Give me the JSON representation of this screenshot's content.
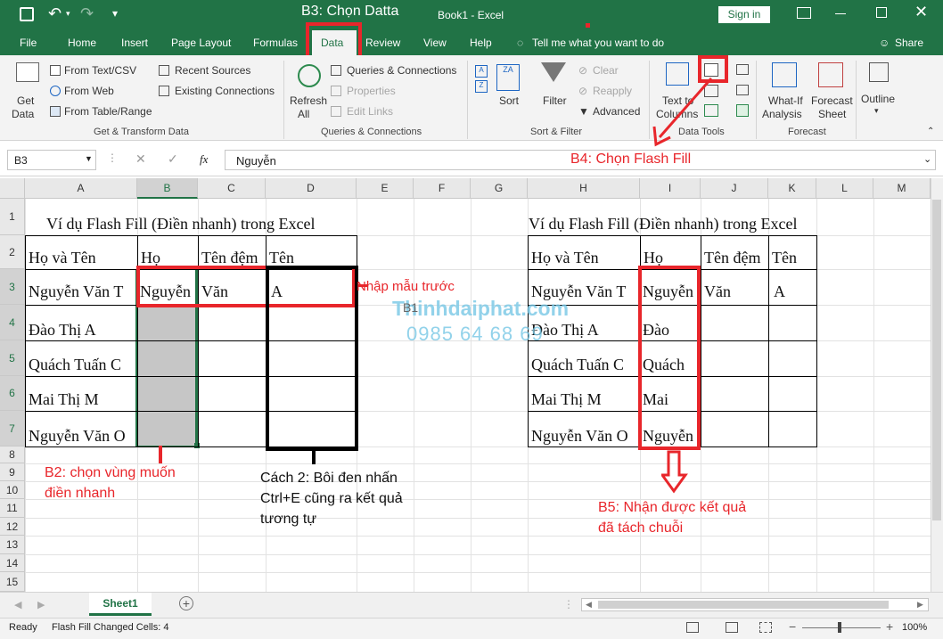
{
  "titlebar": {
    "overlay_title": "B3: Chọn Datta",
    "doc_title": "Book1  -  Excel",
    "signin": "Sign in"
  },
  "tabs": [
    "File",
    "Home",
    "Insert",
    "Page Layout",
    "Formulas",
    "Data",
    "Review",
    "View",
    "Help"
  ],
  "tellme": "Tell me what you want to do",
  "share": "Share",
  "ribbon": {
    "get_data": "Get",
    "get_data2": "Data",
    "from_text": "From Text/CSV",
    "from_web": "From Web",
    "from_table": "From Table/Range",
    "recent_sources": "Recent Sources",
    "existing_connections": "Existing Connections",
    "grp_get": "Get & Transform Data",
    "refresh": "Refresh",
    "refresh2": "All",
    "queries": "Queries & Connections",
    "properties": "Properties",
    "edit_links": "Edit Links",
    "grp_queries": "Queries & Connections",
    "sort": "Sort",
    "filter": "Filter",
    "clear": "Clear",
    "reapply": "Reapply",
    "advanced": "Advanced",
    "grp_sort": "Sort & Filter",
    "text_to_columns": "Text to",
    "text_to_columns2": "Columns",
    "grp_tools": "Data Tools",
    "whatif": "What-If",
    "whatif2": "Analysis",
    "forecast": "Forecast",
    "forecast2": "Sheet",
    "grp_forecast": "Forecast",
    "outline": "Outline"
  },
  "formula_bar": {
    "name_box": "B3",
    "value": "Nguyễn",
    "fx": "fx"
  },
  "columns": [
    "A",
    "B",
    "C",
    "D",
    "E",
    "F",
    "G",
    "H",
    "I",
    "J",
    "K",
    "L",
    "M"
  ],
  "rows": [
    "1",
    "2",
    "3",
    "4",
    "5",
    "6",
    "7",
    "8",
    "9",
    "10",
    "11",
    "12",
    "13",
    "14",
    "15"
  ],
  "left_table": {
    "title": "Ví dụ Flash Fill (Điền nhanh) trong Excel",
    "headers": [
      "Họ và Tên",
      "Họ",
      "Tên đệm",
      "Tên"
    ],
    "names": [
      "Nguyễn Văn T",
      "Đào Thị A",
      "Quách Tuấn C",
      "Mai Thị M",
      "Nguyễn Văn O"
    ],
    "sample": [
      "Nguyễn",
      "Văn",
      "A"
    ]
  },
  "right_table": {
    "title": "Ví dụ Flash Fill (Điền nhanh) trong Excel",
    "headers": [
      "Họ và Tên",
      "Họ",
      "Tên đệm",
      "Tên"
    ],
    "names": [
      "Nguyễn Văn T",
      "Đào Thị A",
      "Quách Tuấn C",
      "Mai Thị M",
      "Nguyễn Văn O"
    ],
    "ho": [
      "Nguyễn",
      "Đào",
      "Quách",
      "Mai",
      "Nguyễn"
    ],
    "sample": [
      "Văn",
      "A"
    ]
  },
  "annotations": {
    "b4": "B4: Chọn Flash Fill",
    "sample": "Nhập mẫu trước",
    "b2_1": "B2: chọn vùng muốn",
    "b2_2": "điền nhanh",
    "c2_1": "Cách 2: Bôi đen nhấn",
    "c2_2": "Ctrl+E cũng ra kết quả",
    "c2_3": "tương tự",
    "b5_1": "B5: Nhận được kết quả",
    "b5_2": "đã tách chuỗi",
    "watermark1": "Thinhdaiphat.com",
    "watermark2": "0985 64 68 69",
    "ghost": "B1"
  },
  "sheet_tab": "Sheet1",
  "status": {
    "ready": "Ready",
    "flash": "Flash Fill Changed Cells: 4",
    "zoom": "100%"
  },
  "colors": {
    "excel_green": "#217346",
    "annotation_red": "#e8262b"
  }
}
